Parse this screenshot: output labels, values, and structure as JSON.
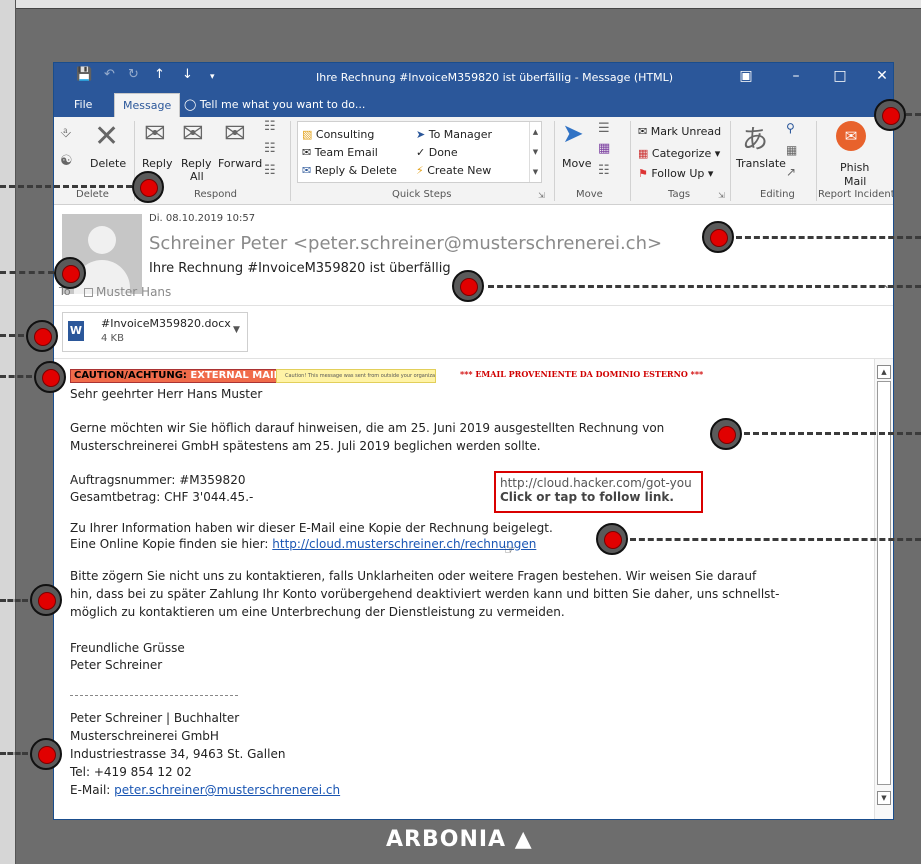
{
  "titlebar": {
    "title": "Ihre Rechnung #InvoiceM359820 ist überfällig  - Message (HTML)",
    "icons": [
      "save-icon",
      "undo-icon",
      "redo-icon",
      "up-arrow-icon",
      "down-arrow-icon",
      "customize-icon"
    ],
    "window_buttons": [
      "restore-icon",
      "minimize-icon",
      "maximize-icon",
      "close-icon"
    ]
  },
  "tabs": {
    "file": "File",
    "message": "Message",
    "tell_me": "Tell me what you want to do..."
  },
  "ribbon": {
    "delete_group": {
      "label": "Delete",
      "delete_btn": "Delete"
    },
    "respond_group": {
      "label": "Respond",
      "reply": "Reply",
      "reply_all_1": "Reply",
      "reply_all_2": "All",
      "forward": "Forward"
    },
    "quick_steps": {
      "label": "Quick Steps",
      "items": [
        "Consulting",
        "To Manager",
        "Team Email",
        "Done",
        "Reply & Delete",
        "Create New"
      ]
    },
    "move_group": {
      "label": "Move",
      "move_btn": "Move"
    },
    "tags_group": {
      "label": "Tags",
      "mark_unread": "Mark Unread",
      "categorize": "Categorize",
      "follow_up": "Follow Up"
    },
    "editing_group": {
      "label": "Editing",
      "translate": "Translate"
    },
    "report_group": {
      "label": "Report Incidents",
      "phish_1": "Phish",
      "phish_2": "Mail"
    }
  },
  "header": {
    "date": "Di. 08.10.2019 10:57",
    "sender": "Schreiner Peter <peter.schreiner@musterschrenerei.ch>",
    "subject": "Ihre Rechnung #InvoiceM359820 ist überfällig",
    "to_label": "To",
    "to_value": "Muster Hans"
  },
  "attachment": {
    "name": "#InvoiceM359820.docx",
    "size": "4 KB"
  },
  "banners": {
    "caution_a": "CAUTION/ACHTUNG:",
    "caution_b": " EXTERNAL MAIL",
    "caution_note": "Caution! This message was sent from outside your organization.",
    "external_notice": "*** EMAIL PROVENIENTE DA DOMINIO ESTERNO ***"
  },
  "body": {
    "greeting": "Sehr geehrter Herr Hans Muster",
    "p1_l1": "Gerne möchten wir Sie höflich darauf hinweisen, die am 25. Juni 2019 ausgestellten Rechnung von",
    "p1_l2": "Musterschreinerei GmbH spätestens am 25. Juli 2019 beglichen werden sollte.",
    "order": "Auftragsnummer: #M359820",
    "total": "Gesamtbetrag: CHF 3'044.45.-",
    "p2_l1": "Zu Ihrer Information haben wir dieser E-Mail eine Kopie der Rechnung beigelegt.",
    "p2_l2_prefix": "Eine Online Kopie finden sie hier: ",
    "link_text": "http://cloud.musterschreiner.ch/rechnungen",
    "p3_l1": "Bitte zögern Sie nicht uns zu kontaktieren, falls Unklarheiten oder weitere Fragen bestehen. Wir weisen Sie darauf",
    "p3_l2": "hin, dass bei zu später Zahlung Ihr Konto vorübergehend deaktiviert werden kann und bitten Sie daher, uns schnellst-",
    "p3_l3": "möglich zu kontaktieren um eine Unterbrechung der Dienstleistung zu vermeiden.",
    "closing": "Freundliche Grüsse",
    "closing_name": "Peter Schreiner",
    "sig_1": "Peter Schreiner | Buchhalter",
    "sig_2": "Musterschreinerei GmbH",
    "sig_3": "Industriestrasse 34, 9463 St. Gallen",
    "sig_4": "Tel: +419 854 12 02",
    "sig_5_prefix": "E-Mail: ",
    "sig_email": "peter.schreiner@musterschrenerei.ch"
  },
  "tooltip": {
    "url": "http://cloud.hacker.com/got-you",
    "hint": "Click or tap to follow link."
  },
  "logo": "ARBONIA"
}
